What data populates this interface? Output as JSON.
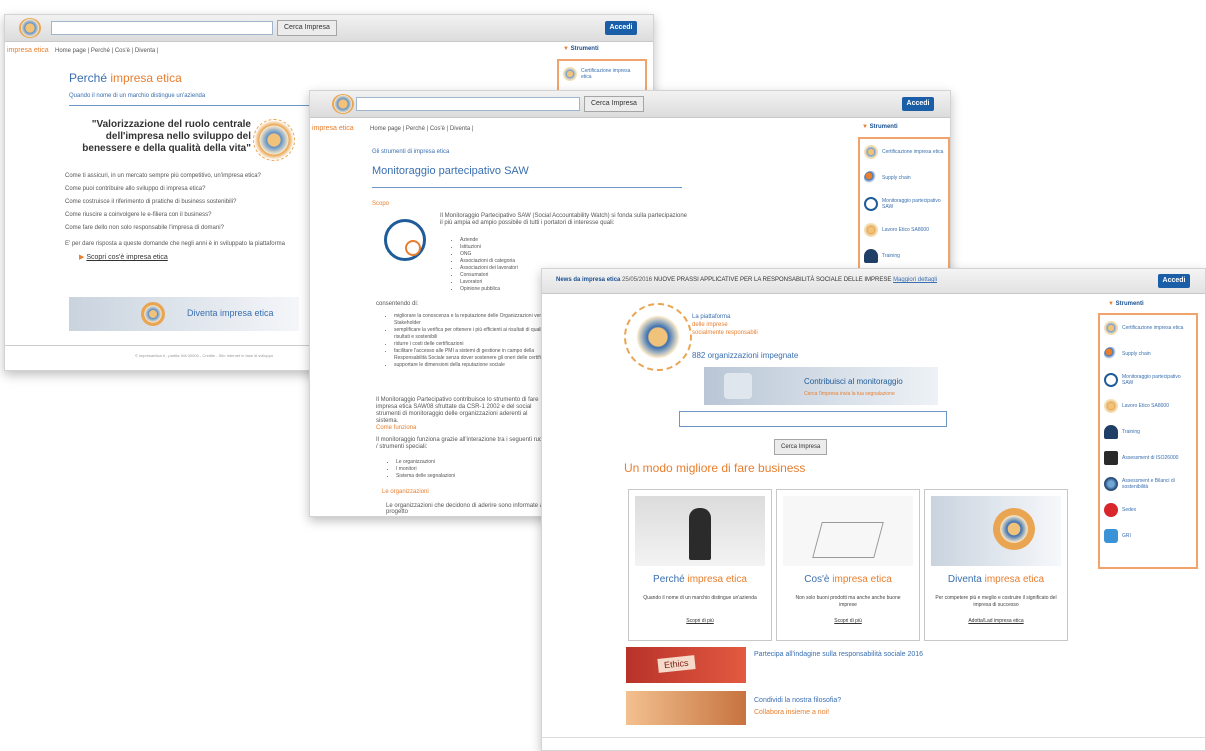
{
  "common": {
    "search_button": "Cerca Impresa",
    "login": "Accedi",
    "tools_header": "Strumenti",
    "brand": "impresa etica",
    "breadcrumb": "Home page | Perché | Cos'è | Diventa |"
  },
  "window1": {
    "title_plain": "Perché",
    "title_brand": "impresa etica",
    "subtitle": "Quando il nome di un marchio distingue un'azienda",
    "quote": "\"Valorizzazione del ruolo centrale dell'impresa nello sviluppo del benessere e della qualità della vita\"",
    "questions": [
      "Come ti assicuri, in un mercato sempre più competitivo, un'impresa etica?",
      "Come puoi contribuire allo sviluppo di impresa etica?",
      "Come costruisce il riferimento di pratiche di business sostenibili?",
      "Come riuscire a coinvolgere le e-filiera con il business?",
      "Come fare dello non solo responsabile l'impresa di domani?"
    ],
    "cta_text": "E' per dare risposta a queste domande che negli anni è in sviluppato la piattaforma",
    "cta_link": "Scopri cos'è impresa etica",
    "become": "Diventa impresa etica",
    "footer": "© impresaetica.it - partita IVA 00000 - Credits - Sito Internet in fase di sviluppo"
  },
  "window2": {
    "crumb": "Gli strumenti di impresa etica",
    "title": "Monitoraggio partecipativo SAW",
    "section_scope": "Scopo",
    "intro": "Il Monitoraggio Partecipativo SAW (Social Accountability Watch) si fonda sulla partecipazione il più ampia ed ampio possibile di tutti i portatori di interesse quali:",
    "stakeholders": [
      "Aziende",
      "Istituzioni",
      "ONG",
      "Associazioni di categoria",
      "Associazioni dei lavoratori",
      "Consumatori",
      "Lavoratori",
      "Opinione pubblica"
    ],
    "goals_label": "consentendo di:",
    "goals": [
      "migliorare la conoscenza e la reputazione delle Organizzazioni verso i propri Stakeholder",
      "semplificare la verifica per ottenere i più efficienti ai risultati di qualità dei risultati e sostenibili",
      "ridurre i costi delle certificazioni",
      "facilitare l'accesso alle PMI a sistemi di gestione in campo della Responsabilità Sociale senza dover sostenere gli oneri delle certificazioni",
      "supportare le dimensioni della reputazione sociale"
    ],
    "para": "Il Monitoraggio Partecipativo contribuisce lo strumento di fare impresa etica SAW08 sfruttate da CSR-1 2002 e del social strumenti di monitoraggio delle organizzazioni aderenti al sistema.",
    "section_how": "Come funziona",
    "how_text": "Il monitoraggio funziona grazie all'interazione tra i seguenti ruoli / strumenti speciali:",
    "roles": [
      "Le organizzazioni",
      "I monitori",
      "Sistema delle segnalazioni"
    ],
    "section_orgs": "Le organizzazioni",
    "orgs_text": "Le organizzazioni che decidono di aderire sono informate al progetto"
  },
  "window3": {
    "news_label": "News da impresa etica",
    "news_date": "25/05/2016",
    "news_text": "NUOVE PRASSI APPLICATIVE PER LA RESPONSABILITÀ SOCIALE DELLE IMPRESE",
    "news_link": "Maggiori dettagli",
    "platform_line1": "La piattaforma",
    "platform_line2": "delle imprese",
    "platform_line3": "socialmente responsabili",
    "orgs_count": "882 organizzazioni impegnate",
    "contribute_title": "Contribuisci al monitoraggio",
    "contribute_sub": "Cerca l'impresa invia la tua segnalazione",
    "headline": "Un modo migliore di fare business",
    "cards": [
      {
        "title_plain": "Perché ",
        "title_brand": "impresa etica",
        "desc": "Quando il nome di un marchio distingue un'azienda",
        "link": "Scopri di più"
      },
      {
        "title_plain": "Cos'è ",
        "title_brand": "impresa etica",
        "desc": "Non solo buoni prodotti ma anche anche buone imprese",
        "link": "Scopri di più"
      },
      {
        "title_plain": "Diventa ",
        "title_brand": "impresa etica",
        "desc": "Per competere più e meglio e costruire il significato del impresa di successo",
        "link": "Adotta/Lad impresa etica"
      }
    ],
    "banner1_title": "Partecipa all'indagine sulla responsabilità sociale 2016",
    "banner1_img": "Ethics",
    "banner2_title": "Condividi la nostra filosofia?",
    "banner2_sub": "Collabora insieme a noi!"
  },
  "tools_w1": [
    "Certificazione impresa etica"
  ],
  "tools_w2": [
    "Certificazione impresa etica",
    "Supply chain",
    "Monitoraggio partecipativo SAW",
    "Lavoro Etico SA8000",
    "Training"
  ],
  "tools_w3": [
    "Certificazione impresa etica",
    "Supply chain",
    "Monitoraggio partecipativo SAW",
    "Lavoro Etico SA8000",
    "Training",
    "Assessment di ISO26000",
    "Assessment e Bilanci di sostenibilità",
    "Sedex",
    "GRI"
  ],
  "colors": {
    "brand_orange": "#e87e2e",
    "link_blue": "#3a6fb0",
    "login_blue": "#1a5ea8"
  }
}
